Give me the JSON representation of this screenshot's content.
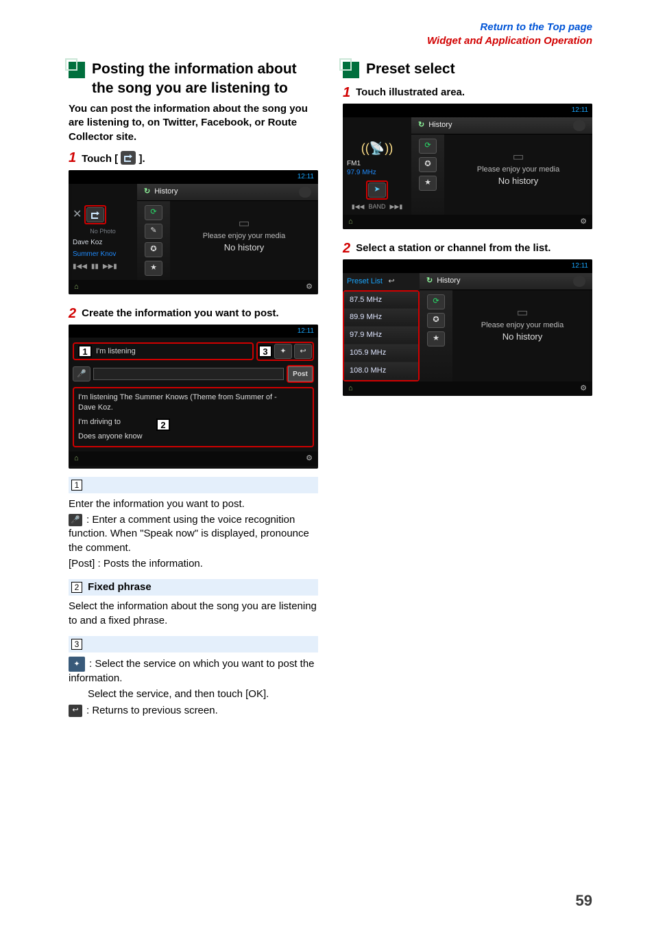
{
  "top_links": {
    "top": "Return to the Top page",
    "section": "Widget and Application Operation"
  },
  "left": {
    "heading": "Posting the information about the song you are listening to",
    "intro": "You can post the information about the song you are listening to, on Twitter, Facebook, or Route Collector site.",
    "step1_pre": "Touch [",
    "step1_post": " ].",
    "step2": "Create the information you want to post.",
    "ss1": {
      "wifi": "12:11",
      "hist": "History",
      "artist": "Dave Koz",
      "track": "Summer Knov",
      "nophoto": "No Photo",
      "msg": "Please enjoy your media",
      "nohist": "No history"
    },
    "ss2": {
      "wifi": "12:11",
      "title": "I'm listening",
      "post_btn": "Post",
      "line1": "I'm listening The Summer Knows (Theme from Summer of  -",
      "line1b": "Dave Koz.",
      "line2": "I'm driving to",
      "line3": "Does anyone know"
    },
    "sub1_body1": "Enter the information you want to post.",
    "sub1_body2a": ": Enter a comment using the voice recognition function. When \"Speak now\" is displayed, pronounce the comment.",
    "sub1_body3": "[Post] : Posts the information.",
    "sub2_title": "Fixed phrase",
    "sub2_body": "Select the information about the song you are listening to and a fixed phrase.",
    "sub3_body1": ": Select the service on which you want to post the information.",
    "sub3_body1b": "Select the service, and then touch [OK].",
    "sub3_body2": ": Returns to previous screen."
  },
  "right": {
    "heading": "Preset select",
    "step1": "Touch illustrated area.",
    "step2": "Select a station or channel from the list.",
    "ss1": {
      "wifi": "12:11",
      "hist": "History",
      "band": "FM1",
      "freq": "97.9 MHz",
      "msg": "Please enjoy your media",
      "nohist": "No history",
      "band_btn": "BAND"
    },
    "ss2": {
      "wifi": "12:11",
      "hist": "History",
      "preset": "Preset List",
      "items": [
        "87.5  MHz",
        "89.9  MHz",
        "97.9  MHz",
        "105.9  MHz",
        "108.0  MHz"
      ],
      "msg": "Please enjoy your media",
      "nohist": "No history"
    }
  },
  "page_number": "59"
}
